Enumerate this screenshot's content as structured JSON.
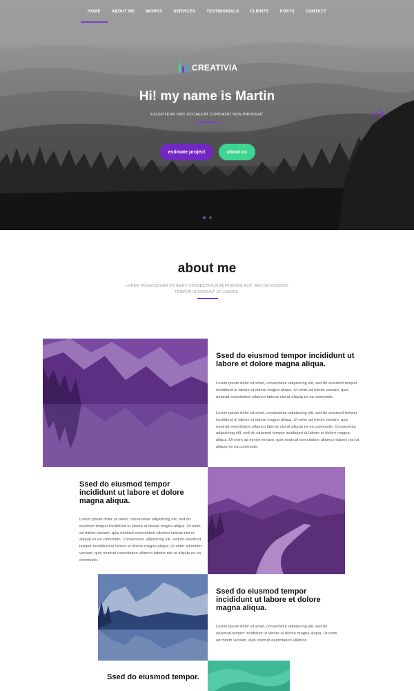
{
  "nav": {
    "items": [
      "HOME",
      "ABOUT ME",
      "WORKS",
      "SERVICES",
      "TESTIMONIALS",
      "CLIENTS",
      "POSTS",
      "CONTACT"
    ],
    "active_index": 0
  },
  "hero": {
    "logo_text": "CREATIVIA",
    "title": "Hi! my name is Martin",
    "subtitle": "EXCEPTEUR SINT OCCAECAT CUPIDATAT NON PROIDENT",
    "estimate_label": "estimate project",
    "about_label": "about us",
    "slide_count": 2,
    "active_slide": 0
  },
  "about": {
    "title": "about me",
    "subtitle": "LOREM IPSUM DOLOR SIT AMET, CONSECTETUR ADIPISICING ELIT, SED DO EIUSMOD TEMPOR INCIDIDUNT UT LABORE."
  },
  "blocks": [
    {
      "title": "Ssed do eiusmod tempor incididunt ut labore et dolore magna aliqua.",
      "para1": "Lorem ipsum dolor sit amet, consectetur adipisicing elit, sed do eiusmod tempor incididunt ut labore et dolore magna aliqua. Ut enim ad minim veniam, quis nostrud exercitation ullamco laboris nisi ut aliquip ex ea commodo.",
      "para2": "Lorem ipsum dolor sit amet, consectetur adipisicing elit, sed do eiusmod tempor incididunt ut labore et dolore magna aliqua. Ut enim ad minim veniam, quis nostrud exercitation ullamco laboris nisi ut aliquip ex ea commodo. Consectetur adipisicing elit, sed do eiusmod tempor incididunt ut labore et dolore magna aliqua. Ut enim ad minim veniam, quis nostrud exercitation ullamco laboris nisi ut aliquip ex ea commodo."
    },
    {
      "title": "Ssed do eiusmod tempor incididunt ut labore et dolore magna aliqua.",
      "para1": "Lorem ipsum dolor sit amet, consectetur adipisicing elit, sed do eiusmod tempor incididunt ut labore et dolore magna aliqua. Ut enim ad minim veniam, quis nostrud exercitation ullamco laboris nisi ut aliquip ex ea commodo. Consectetur adipisicing elit, sed do eiusmod tempor incididunt ut labore et dolore magna aliqua. Ut enim ad minim veniam, quis nostrud exercitation ullamco laboris nisi ut aliquip ex ea commodo."
    },
    {
      "title": "Ssed do eiusmod tempor incididunt ut labore et dolore magna aliqua.",
      "para1": "Lorem ipsum dolor sit amet, consectetur adipisicing elit, sed do eiusmod tempor incididunt ut labore et dolore magna aliqua. Ut enim ad minim veniam, quis nostrud exercitation ullamco."
    },
    {
      "title": "Ssed do eiusmod tempor."
    }
  ],
  "colors": {
    "accent_purple": "#7d3bd0",
    "button_purple": "#7427c4",
    "button_green": "#3fd58f",
    "photo_purple": "#6f3f95",
    "photo_blue": "#3f5a8e",
    "photo_green": "#3fb896"
  }
}
